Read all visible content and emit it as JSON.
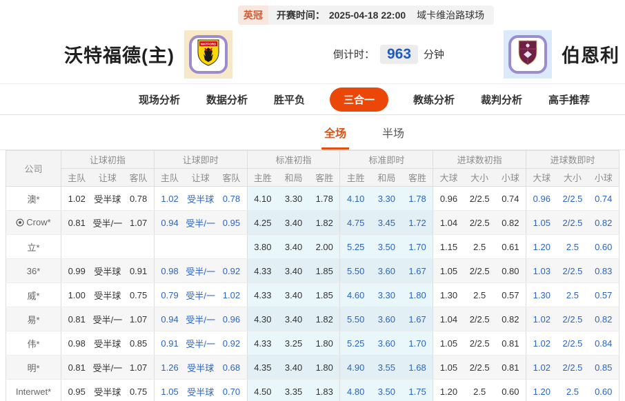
{
  "match_bar": {
    "league": "英冠",
    "kickoff_label": "开赛时间：",
    "kickoff_time": "2025-04-18 22:00",
    "venue": "域卡维治路球场"
  },
  "header": {
    "home_name": "沃特福德(主)",
    "away_name": "伯恩利",
    "countdown_label": "倒计时：",
    "countdown_minutes": "963",
    "countdown_unit": "分钟"
  },
  "nav_tabs": [
    {
      "label": "现场分析",
      "active": false
    },
    {
      "label": "数据分析",
      "active": false
    },
    {
      "label": "胜平负",
      "active": false
    },
    {
      "label": "三合一",
      "active": true
    },
    {
      "label": "教练分析",
      "active": false
    },
    {
      "label": "裁判分析",
      "active": false
    },
    {
      "label": "高手推荐",
      "active": false
    }
  ],
  "sub_tabs": [
    {
      "label": "全场",
      "active": true
    },
    {
      "label": "半场",
      "active": false
    }
  ],
  "colors": {
    "accent": "#ea4708",
    "live_blue": "#2a64c5",
    "std_col_bg": "#e9f6fa"
  },
  "odds_table": {
    "company_header": "公司",
    "groups": [
      "让球初指",
      "让球即时",
      "标准初指",
      "标准即时",
      "进球数初指",
      "进球数即时"
    ],
    "sub_headers": [
      "主队",
      "让球",
      "客队",
      "主队",
      "让球",
      "客队",
      "主胜",
      "和局",
      "客胜",
      "主胜",
      "和局",
      "客胜",
      "大球",
      "大小",
      "小球",
      "大球",
      "大小",
      "小球"
    ],
    "rows": [
      {
        "company": "澳*",
        "has_icon": false,
        "cells": [
          "1.02",
          "受半球",
          "0.78",
          "1.02",
          "受半球",
          "0.78",
          "4.10",
          "3.30",
          "1.78",
          "4.10",
          "3.30",
          "1.78",
          "0.96",
          "2/2.5",
          "0.74",
          "0.96",
          "2/2.5",
          "0.74"
        ]
      },
      {
        "company": "Crow*",
        "has_icon": true,
        "cells": [
          "0.81",
          "受半/一",
          "1.07",
          "0.94",
          "受半/一",
          "0.95",
          "4.25",
          "3.40",
          "1.82",
          "4.75",
          "3.45",
          "1.72",
          "1.04",
          "2/2.5",
          "0.82",
          "1.05",
          "2/2.5",
          "0.82"
        ]
      },
      {
        "company": "立*",
        "has_icon": false,
        "cells": [
          "",
          "",
          "",
          "",
          "",
          "",
          "3.80",
          "3.40",
          "2.00",
          "5.25",
          "3.50",
          "1.70",
          "1.15",
          "2.5",
          "0.61",
          "1.20",
          "2.5",
          "0.60"
        ]
      },
      {
        "company": "36*",
        "has_icon": false,
        "cells": [
          "0.99",
          "受半球",
          "0.91",
          "0.98",
          "受半/一",
          "0.92",
          "4.33",
          "3.40",
          "1.85",
          "5.50",
          "3.60",
          "1.67",
          "1.05",
          "2/2.5",
          "0.80",
          "1.03",
          "2/2.5",
          "0.83"
        ]
      },
      {
        "company": "威*",
        "has_icon": false,
        "cells": [
          "1.00",
          "受半球",
          "0.75",
          "0.79",
          "受半/一",
          "1.02",
          "4.33",
          "3.40",
          "1.85",
          "4.60",
          "3.30",
          "1.80",
          "1.30",
          "2.5",
          "0.57",
          "1.30",
          "2.5",
          "0.57"
        ]
      },
      {
        "company": "易*",
        "has_icon": false,
        "cells": [
          "0.81",
          "受半/一",
          "1.07",
          "0.94",
          "受半/一",
          "0.96",
          "4.30",
          "3.40",
          "1.82",
          "5.50",
          "3.60",
          "1.67",
          "1.04",
          "2/2.5",
          "0.82",
          "1.02",
          "2/2.5",
          "0.82"
        ]
      },
      {
        "company": "伟*",
        "has_icon": false,
        "cells": [
          "0.98",
          "受半球",
          "0.85",
          "0.91",
          "受半/一",
          "0.92",
          "4.33",
          "3.25",
          "1.80",
          "5.25",
          "3.60",
          "1.70",
          "1.05",
          "2/2.5",
          "0.81",
          "1.02",
          "2/2.5",
          "0.84"
        ]
      },
      {
        "company": "明*",
        "has_icon": false,
        "cells": [
          "0.81",
          "受半/一",
          "1.07",
          "1.26",
          "受半球",
          "0.68",
          "4.35",
          "3.40",
          "1.80",
          "4.90",
          "3.55",
          "1.68",
          "1.05",
          "2/2.5",
          "0.81",
          "1.02",
          "2/2.5",
          "0.85"
        ]
      },
      {
        "company": "Interwet*",
        "has_icon": false,
        "cells": [
          "0.95",
          "受半球",
          "0.75",
          "1.05",
          "受半球",
          "0.70",
          "4.50",
          "3.35",
          "1.83",
          "4.80",
          "3.50",
          "1.75",
          "1.20",
          "2.5",
          "0.60",
          "1.20",
          "2.5",
          "0.60"
        ]
      }
    ]
  }
}
